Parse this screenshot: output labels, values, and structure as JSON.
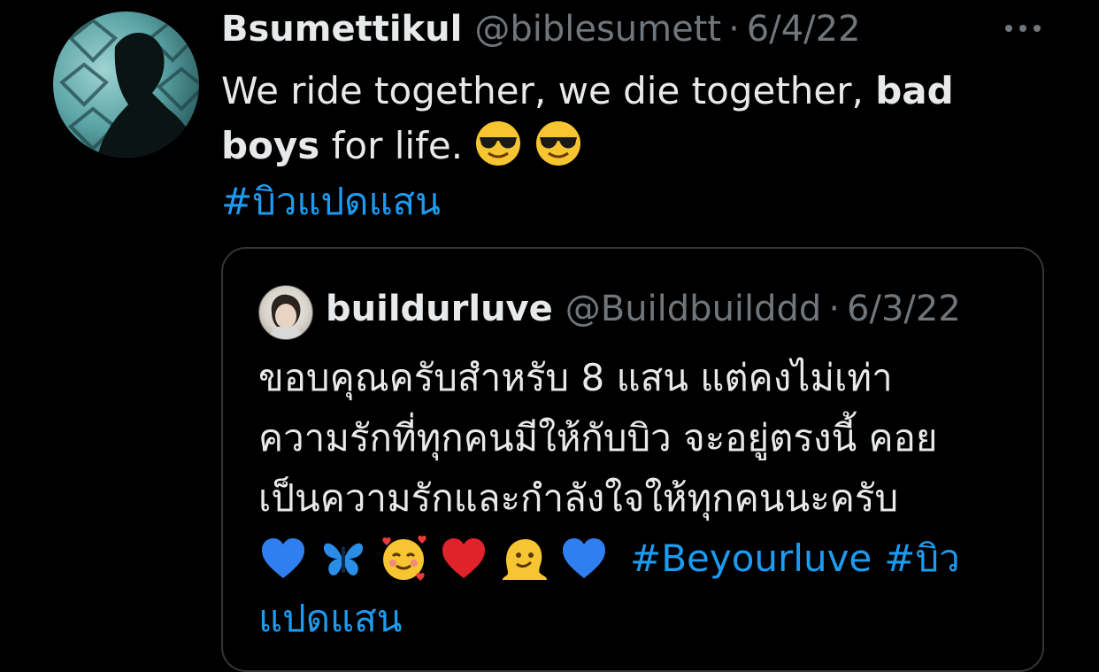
{
  "tweet": {
    "display_name": "Bsumettikul",
    "handle": "@biblesumett",
    "separator": "·",
    "date": "6/4/22",
    "text_part1": "We ride together, we die together, ",
    "text_bold1": "bad",
    "text_bold2": "boys",
    "text_part2": " for life.",
    "emojis": [
      "sunglasses-emoji",
      "sunglasses-emoji"
    ],
    "hashtag": "#บิวแปดแสน",
    "more_icon": "more-horizontal-icon"
  },
  "quoted_tweet": {
    "display_name": "buildurluve",
    "handle": "@Buildbuilddd",
    "separator": "·",
    "date": "6/3/22",
    "lines": [
      "ขอบคุณครับสำหรับ 8 แสน แต่คงไม่เท่า",
      "ความรักที่ทุกคนมีให้กับบิว จะอยู่ตรงนี้ คอย",
      "เป็นความรักและกำลังใจให้ทุกคนนะครับ"
    ],
    "emojis": [
      "blue-heart-emoji",
      "butterfly-emoji",
      "smiling-face-hearts-emoji",
      "red-heart-emoji",
      "melting-face-emoji",
      "blue-heart-emoji"
    ],
    "hashtag1": "#Beyourluve",
    "hashtag2": "#บิว",
    "hashtag2_cont": "แปดแสน"
  },
  "colors": {
    "background": "#000000",
    "text": "#e7e9ea",
    "muted": "#71767b",
    "link": "#1d9bf0",
    "border": "#333639"
  }
}
